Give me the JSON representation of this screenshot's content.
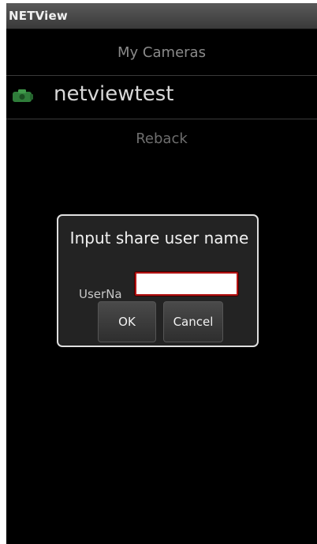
{
  "titlebar": {
    "app_name": "NETView"
  },
  "cameras": {
    "header": "My Cameras",
    "items": [
      {
        "name": "netviewtest",
        "icon": "camera-icon"
      }
    ],
    "reback_label": "Reback"
  },
  "dialog": {
    "title": "Input share user name",
    "field_label": "UserNa",
    "username_value": "",
    "ok_label": "OK",
    "cancel_label": "Cancel"
  },
  "colors": {
    "background": "#000000",
    "input_border": "#b31313",
    "camera_icon": "#2f7d3a"
  }
}
